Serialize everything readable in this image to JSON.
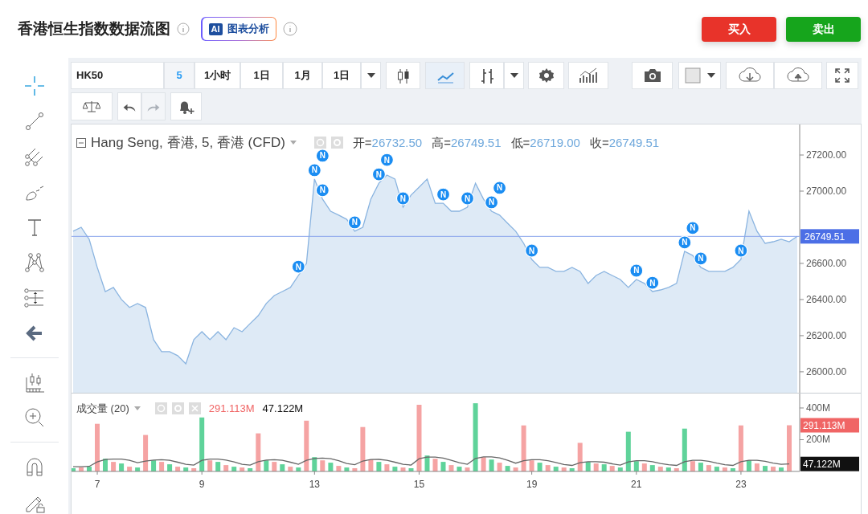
{
  "header": {
    "title": "香港恒生指数数据流图",
    "ai_button": {
      "badge": "AI",
      "label": "图表分析"
    },
    "actions": [
      {
        "label": "买入",
        "kind": "buy"
      },
      {
        "label": "卖出",
        "kind": "sell"
      }
    ]
  },
  "toolbar": {
    "symbol": "HK50",
    "intervals": [
      {
        "label": "5",
        "selected": true
      },
      {
        "label": "1小时",
        "selected": false
      },
      {
        "label": "1日",
        "selected": false
      },
      {
        "label": "1月",
        "selected": false
      },
      {
        "label": "1日",
        "selected": false
      }
    ],
    "chart_types": [
      {
        "kind": "candles",
        "selected": false
      },
      {
        "kind": "line",
        "selected": true
      },
      {
        "kind": "bars",
        "selected": false
      }
    ],
    "history": [
      {
        "kind": "undo",
        "disabled": false
      },
      {
        "kind": "redo",
        "disabled": true
      }
    ]
  },
  "tool_groups": [
    {
      "tools": [
        {
          "kind": "crosshair",
          "selected": true
        },
        {
          "kind": "trendline",
          "selected": false
        },
        {
          "kind": "pitchfork",
          "selected": false
        },
        {
          "kind": "brush",
          "selected": false
        },
        {
          "kind": "text",
          "selected": false
        },
        {
          "kind": "pattern",
          "selected": false
        },
        {
          "kind": "measure",
          "selected": false
        },
        {
          "kind": "arrow",
          "selected": false
        }
      ]
    },
    {
      "tools": [
        {
          "kind": "ruler",
          "selected": false
        },
        {
          "kind": "zoom",
          "selected": false
        }
      ]
    },
    {
      "tools": [
        {
          "kind": "magnet",
          "selected": false
        },
        {
          "kind": "lock",
          "selected": false
        }
      ]
    }
  ],
  "price_pane": {
    "legend": {
      "title": "Hang Seng, 香港, 5, 香港 (CFD)",
      "fields": [
        {
          "label": "开=",
          "value": "26732.50"
        },
        {
          "label": "高=",
          "value": "26749.51"
        },
        {
          "label": "低=",
          "value": "26719.00"
        },
        {
          "label": "收=",
          "value": "26749.51"
        }
      ]
    },
    "news_markers": [
      {
        "text": "N"
      },
      {
        "text": "N"
      },
      {
        "text": "N"
      },
      {
        "text": "N"
      },
      {
        "text": "N"
      },
      {
        "text": "N"
      },
      {
        "text": "N"
      },
      {
        "text": "N"
      },
      {
        "text": "N"
      },
      {
        "text": "N"
      },
      {
        "text": "N"
      },
      {
        "text": "N"
      },
      {
        "text": "N"
      },
      {
        "text": "N"
      },
      {
        "text": "N"
      },
      {
        "text": "N"
      },
      {
        "text": "N"
      },
      {
        "text": "N"
      },
      {
        "text": "N"
      }
    ],
    "chart_data": {
      "type": "area",
      "series": [
        {
          "color": "#8ab4e0",
          "values": [
            26778,
            26800,
            26733,
            26578,
            26444,
            26467,
            26400,
            26356,
            26378,
            26356,
            26178,
            26111,
            26111,
            26089,
            26044,
            26178,
            26222,
            26178,
            26222,
            26178,
            26244,
            26222,
            26267,
            26311,
            26378,
            26422,
            26444,
            26467,
            26533,
            26600,
            27067,
            26956,
            26889,
            26867,
            26844,
            26778,
            26800,
            26956,
            27044,
            27089,
            27067,
            26911,
            26978,
            27022,
            27067,
            26933,
            26933,
            26889,
            26889,
            26911,
            27044,
            26956,
            26889,
            26867,
            26822,
            26778,
            26711,
            26622,
            26578,
            26578,
            26556,
            26556,
            26578,
            26556,
            26489,
            26533,
            26556,
            26533,
            26511,
            26467,
            26511,
            26489,
            26444,
            26453,
            26467,
            26489,
            26667,
            26644,
            26578,
            26556,
            26556,
            26556,
            26578,
            26622,
            26889,
            26778,
            26711,
            26720,
            26733,
            26720,
            26750
          ]
        }
      ],
      "ylim": [
        25884,
        27369
      ],
      "yticks": [
        {
          "value": 26000,
          "label": "26000.00"
        },
        {
          "value": 26200,
          "label": "26200.00"
        },
        {
          "value": 26400,
          "label": "26400.00"
        },
        {
          "value": 26600,
          "label": "26600.00"
        },
        {
          "value": 27000,
          "label": "27000.00"
        },
        {
          "value": 27200,
          "label": "27200.00"
        }
      ],
      "ref_lines": [
        {
          "value": 26749.51,
          "axis": "y",
          "label": "26749.51"
        }
      ]
    }
  },
  "volume_pane": {
    "legend": {
      "title": "成交量 (20)",
      "values": [
        {
          "text": "291.113M",
          "kind": "last_volume"
        },
        {
          "text": "47.122M",
          "kind": "average"
        }
      ]
    },
    "axis_labels": [
      {
        "text": "291.113M",
        "kind": "last_volume"
      },
      {
        "text": "47.122M",
        "kind": "average"
      }
    ],
    "chart_data": {
      "type": "bar",
      "categories": [
        null,
        null,
        null,
        "7",
        null,
        null,
        null,
        null,
        null,
        null,
        null,
        null,
        null,
        null,
        null,
        null,
        "9",
        null,
        null,
        null,
        null,
        null,
        null,
        null,
        null,
        null,
        null,
        null,
        null,
        null,
        "13",
        null,
        null,
        null,
        null,
        null,
        null,
        null,
        null,
        null,
        null,
        null,
        null,
        "15",
        null,
        null,
        null,
        null,
        null,
        null,
        null,
        null,
        null,
        null,
        null,
        null,
        null,
        "19",
        null,
        null,
        null,
        null,
        null,
        null,
        null,
        null,
        null,
        null,
        null,
        null,
        "21",
        null,
        null,
        null,
        null,
        null,
        null,
        null,
        null,
        null,
        null,
        null,
        null,
        "23",
        null,
        null,
        null,
        null,
        null,
        null
      ],
      "series": [
        {
          "color": "#5fd39a",
          "values": [
            20,
            null,
            30,
            null,
            80,
            null,
            50,
            null,
            25,
            null,
            70,
            null,
            45,
            null,
            25,
            null,
            340,
            null,
            60,
            null,
            30,
            null,
            20,
            null,
            70,
            null,
            45,
            null,
            25,
            null,
            90,
            null,
            55,
            null,
            25,
            null,
            null,
            null,
            60,
            null,
            30,
            null,
            20,
            null,
            100,
            null,
            60,
            null,
            30,
            null,
            430,
            null,
            75,
            null,
            35,
            null,
            null,
            null,
            55,
            null,
            30,
            null,
            20,
            null,
            60,
            null,
            45,
            null,
            25,
            250,
            65,
            null,
            40,
            null,
            25,
            null,
            270,
            null,
            55,
            null,
            30,
            null,
            20,
            null,
            70,
            null,
            35,
            null,
            25,
            null
          ]
        },
        {
          "color": "#f5a3a3",
          "values": [
            null,
            25,
            null,
            300,
            null,
            60,
            null,
            30,
            null,
            230,
            null,
            60,
            null,
            30,
            null,
            20,
            null,
            70,
            null,
            40,
            null,
            25,
            null,
            240,
            null,
            60,
            null,
            30,
            null,
            320,
            null,
            70,
            null,
            35,
            null,
            20,
            280,
            75,
            null,
            45,
            null,
            25,
            null,
            420,
            null,
            80,
            null,
            40,
            null,
            25,
            null,
            90,
            null,
            55,
            null,
            25,
            290,
            70,
            null,
            40,
            null,
            25,
            null,
            180,
            null,
            50,
            null,
            35,
            null,
            null,
            null,
            50,
            null,
            30,
            null,
            20,
            null,
            65,
            null,
            40,
            null,
            25,
            null,
            290,
            null,
            50,
            null,
            30,
            null,
            291
          ]
        },
        {
          "type": "line",
          "color": "#666666",
          "values": [
            30,
            30,
            32,
            60,
            75,
            78,
            78,
            70,
            55,
            65,
            72,
            74,
            70,
            58,
            45,
            40,
            70,
            78,
            78,
            72,
            60,
            45,
            40,
            62,
            72,
            74,
            70,
            58,
            45,
            70,
            82,
            84,
            80,
            68,
            50,
            42,
            66,
            75,
            76,
            70,
            58,
            45,
            40,
            80,
            90,
            90,
            84,
            70,
            55,
            45,
            82,
            92,
            92,
            85,
            70,
            52,
            68,
            74,
            74,
            68,
            56,
            44,
            38,
            55,
            62,
            62,
            58,
            48,
            40,
            60,
            68,
            68,
            62,
            50,
            42,
            38,
            62,
            70,
            70,
            64,
            52,
            42,
            38,
            62,
            70,
            70,
            64,
            52,
            45,
            47
          ]
        }
      ],
      "ylim": [
        0,
        491
      ],
      "yticks": [
        {
          "value": 200,
          "label": "200M"
        },
        {
          "value": 400,
          "label": "400M"
        }
      ]
    }
  }
}
